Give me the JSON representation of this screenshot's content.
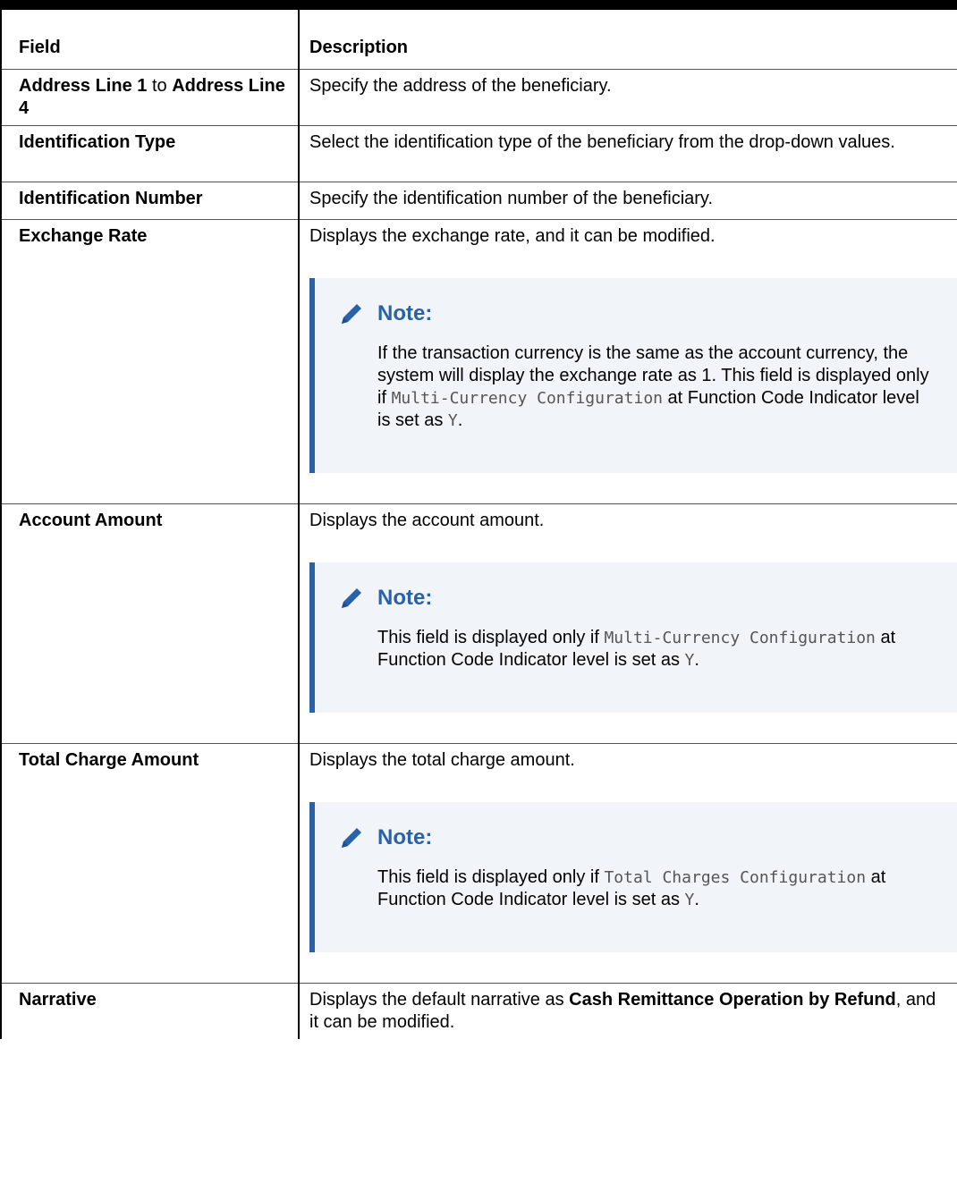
{
  "table": {
    "headers": {
      "field": "Field",
      "description": "Description"
    },
    "rows": {
      "address": {
        "field_part1": "Address Line 1",
        "field_part2": " to ",
        "field_part3": "Address Line 4",
        "description": "Specify the address of the beneficiary."
      },
      "id_type": {
        "field": "Identification Type",
        "description": "Select the identification type of the beneficiary from the drop-down values."
      },
      "id_number": {
        "field": "Identification Number",
        "description": "Specify the identification number of the beneficiary."
      },
      "exchange_rate": {
        "field": "Exchange Rate",
        "description": "Displays the exchange rate, and it can be modified.",
        "note_title": "Note:",
        "note_text1": "If the transaction currency is the same as the account currency, the system will display the exchange rate as 1. This field is displayed only if ",
        "note_code1": "Multi-Currency Configuration",
        "note_text2": " at Function Code Indicator level is set as ",
        "note_code2": "Y",
        "note_text3": "."
      },
      "account_amount": {
        "field": "Account Amount",
        "description": "Displays the account amount.",
        "note_title": "Note:",
        "note_text1": "This field is displayed only if ",
        "note_code1": "Multi-Currency Configuration",
        "note_text2": " at Function Code Indicator level is set as ",
        "note_code2": "Y",
        "note_text3": "."
      },
      "total_charge": {
        "field": "Total Charge Amount",
        "description": "Displays the total charge amount.",
        "note_title": "Note:",
        "note_text1": "This field is displayed only if ",
        "note_code1": "Total Charges Configuration",
        "note_text2": " at Function Code Indicator level is set as ",
        "note_code2": "Y",
        "note_text3": "."
      },
      "narrative": {
        "field": "Narrative",
        "desc_part1": "Displays the default narrative as ",
        "desc_bold": "Cash Remittance Operation by Refund",
        "desc_part2": ", and it can be modified."
      }
    }
  },
  "colors": {
    "note_accent": "#2a62a8",
    "note_background": "#f1f5f9"
  },
  "icons": {
    "note": "pencil-icon"
  }
}
